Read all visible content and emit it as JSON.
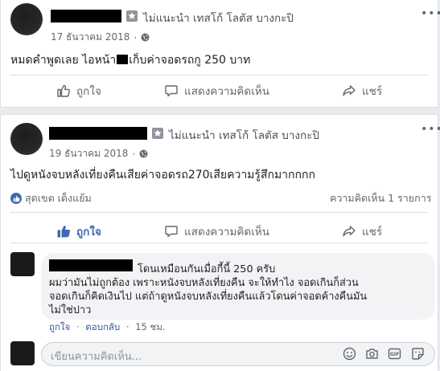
{
  "post1": {
    "page_name": "ไม่แนะนำ เทสโก้ โลตัส บางกะปิ",
    "date": "17 ธันวาคม 2018",
    "dot": "·",
    "text": "หมดคำพูดเลย ไอหน้า",
    "text_after": "เก็บค่าจอดรถกู 250 บาท",
    "more": "•••",
    "actions": {
      "like": "ถูกใจ",
      "comment": "แสดงความคิดเห็น",
      "share": "แชร์"
    }
  },
  "post2": {
    "page_name": "ไม่แนะนำ เทสโก้ โลตัส บางกะปิ",
    "date": "19 ธันวาคม 2018",
    "dot": "·",
    "text": "ไปดูหนังจบหลังเที่ยงคืนเสียค่าจอดรถ270เสียความรู้สึกมากกกก",
    "more": "•••",
    "reactions_text": "สุดเขต เด็งแย้ม",
    "comments_count": "ความคิดเห็น 1 รายการ",
    "actions": {
      "like": "ถูกใจ",
      "comment": "แสดงความคิดเห็น",
      "share": "แชร์"
    },
    "comment": {
      "lines": [
        "โดนเหมือนกันเมื่อกี้นี้ 250 ครับ",
        "ผมว่ามันไม่ถูกต้อง เพราะหนังจบหลังเที่ยงคืน จะให้ทำไง จอดเกินก็ส่วน",
        "จอดเกินก็คิดเงินไป แต่ถ้าดูหนังจบหลังเที่ยงคืนแล้วโดนค่าจอดค้างคืนมัน",
        "ไม่ใช่ปาว"
      ],
      "like": "ถูกใจ",
      "reply": "ตอบกลับ",
      "time": "15 ชม.",
      "dot": "·"
    },
    "composer": {
      "placeholder": "เขียนความคิดเห็น..."
    }
  },
  "colors": {
    "accent": "#4267b2",
    "link": "#385898",
    "muted": "#606770",
    "background": "#e9ebee"
  },
  "icons": [
    "star-icon",
    "globe-icon",
    "more-dots-icon",
    "like-icon",
    "comment-icon",
    "share-icon",
    "emoji-icon",
    "camera-icon",
    "gif-icon",
    "sticker-icon"
  ]
}
